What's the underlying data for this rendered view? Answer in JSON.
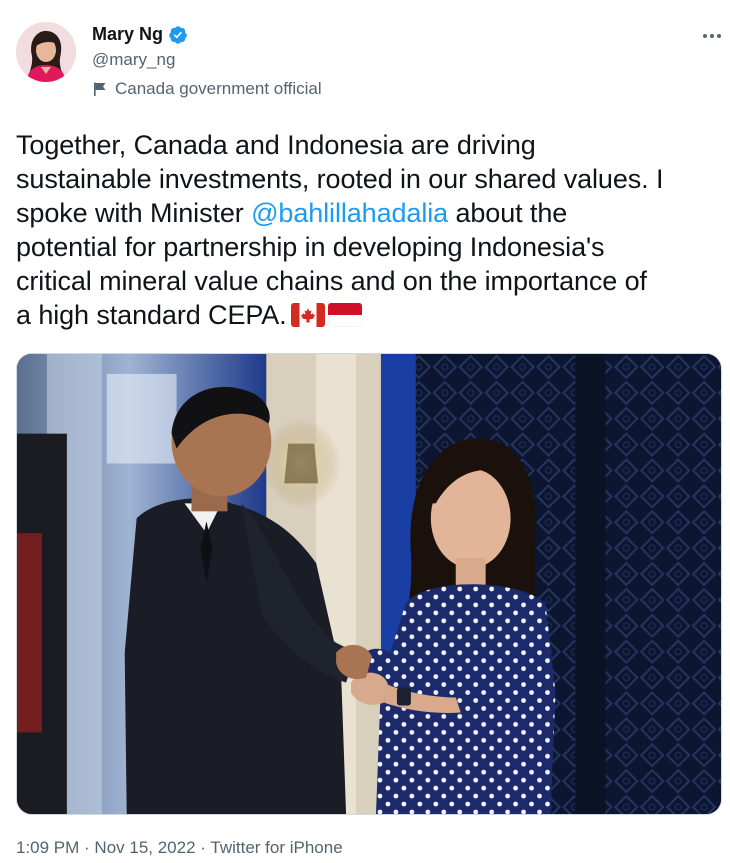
{
  "author": {
    "display_name": "Mary Ng",
    "handle": "@mary_ng",
    "label": "Canada government official",
    "avatar_icon": "profile-photo",
    "verified_icon": "verified-badge-icon",
    "label_icon": "flag-icon"
  },
  "menu": {
    "more_icon": "more-horizontal-icon"
  },
  "tweet": {
    "line1": "Together, Canada and Indonesia are driving",
    "line2": "sustainable investments, rooted in our shared values. I",
    "line3_prefix": "spoke with Minister ",
    "mention": "@bahlillahadalia",
    "line3_suffix": " about the",
    "line4": "potential for partnership in developing Indonesia's",
    "line5": "critical mineral value chains and on the importance of",
    "line6": "a high standard CEPA.",
    "emojis": [
      "canada-flag-icon",
      "indonesia-flag-icon"
    ]
  },
  "meta": {
    "time": "1:09 PM",
    "separator1": " · ",
    "date": "Nov 15, 2022",
    "separator2": " · ",
    "source": "Twitter for iPhone"
  },
  "colors": {
    "link": "#1d9bf0",
    "text": "#0f1419",
    "secondary": "#536471",
    "verified": "#1d9bf0",
    "canada_red": "#d52b1e",
    "indonesia_red": "#ce1126"
  }
}
